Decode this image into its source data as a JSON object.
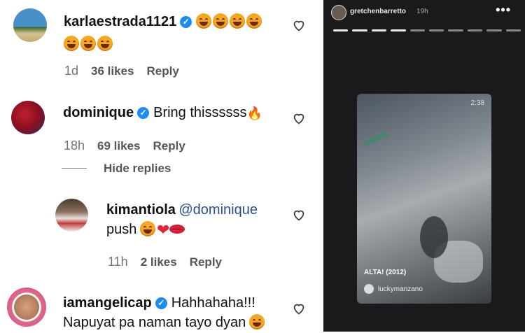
{
  "comments": [
    {
      "username": "karlaestrada1121",
      "text": "",
      "age": "1d",
      "likes": "36 likes",
      "reply": "Reply"
    },
    {
      "username": "dominique",
      "text": "Bring thissssss",
      "age": "18h",
      "likes": "69 likes",
      "reply": "Reply",
      "hide_replies": "Hide replies"
    },
    {
      "username": "kimantiola",
      "mention": "@dominique",
      "text": "push",
      "age": "11h",
      "likes": "2 likes",
      "reply": "Reply"
    },
    {
      "username": "iamangelicap",
      "text": "Hahhahaha!!!",
      "text2": "Napuyat pa naman tayo dyan"
    }
  ],
  "story": {
    "username": "gretchenbarretto",
    "time": "19h",
    "more": "•••",
    "video_time": "2:38",
    "video_label": "ALTA! (2012)",
    "video_user": "luckymanzano"
  },
  "icons": {
    "heart": "heart-outline-icon",
    "verified": "verified-badge-icon"
  }
}
